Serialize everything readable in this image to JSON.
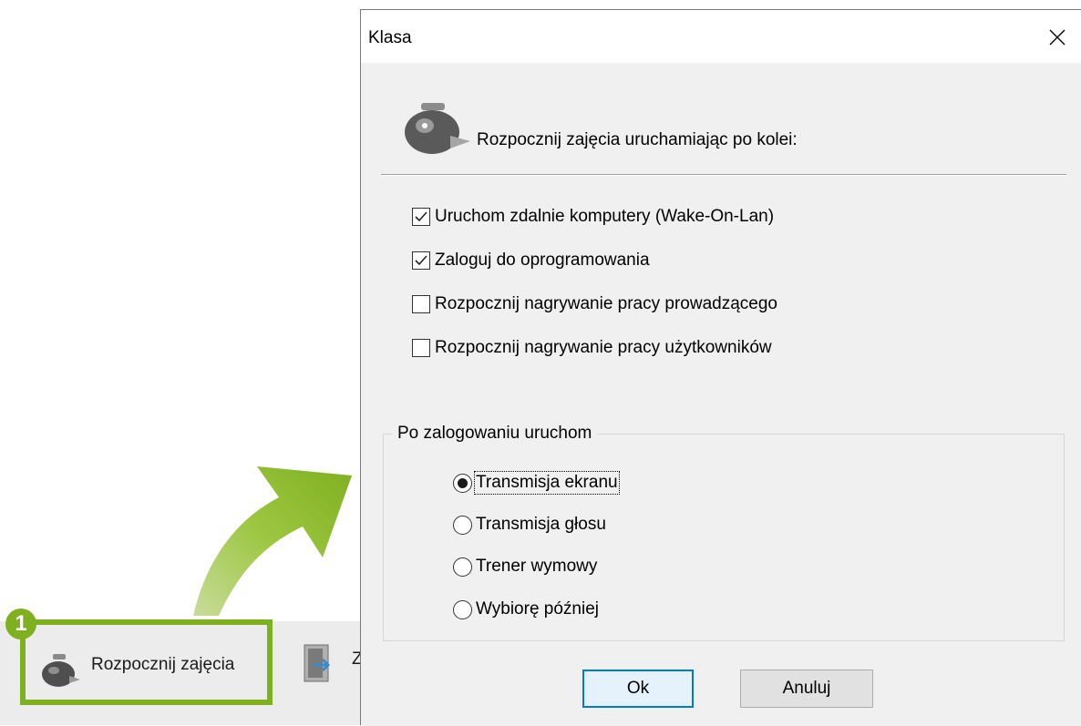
{
  "background_toolbar": {
    "step_number": "1",
    "start_button_label": "Rozpocznij zajęcia",
    "next_button_label_partial": "Z",
    "highlight_color": "#7fb020"
  },
  "dialog": {
    "title": "Klasa",
    "header_text": "Rozpocznij zajęcia uruchamiając po kolei:",
    "checkboxes": [
      {
        "label": "Uruchom zdalnie komputery (Wake-On-Lan)",
        "checked": true
      },
      {
        "label": "Zaloguj do oprogramowania",
        "checked": true
      },
      {
        "label": "Rozpocznij nagrywanie pracy prowadzącego",
        "checked": false
      },
      {
        "label": "Rozpocznij nagrywanie pracy użytkowników",
        "checked": false
      }
    ],
    "group_title": "Po zalogowaniu uruchom",
    "radios": [
      {
        "label": "Transmisja ekranu",
        "selected": true
      },
      {
        "label": "Transmisja głosu",
        "selected": false
      },
      {
        "label": "Trener wymowy",
        "selected": false
      },
      {
        "label": "Wybiorę później",
        "selected": false
      }
    ],
    "ok_label": "Ok",
    "cancel_label": "Anuluj"
  }
}
